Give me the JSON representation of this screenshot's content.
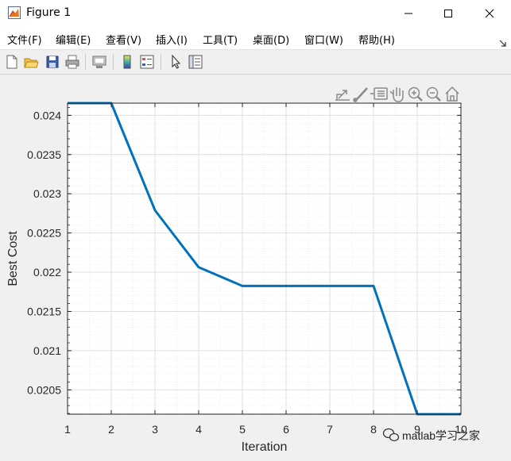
{
  "window": {
    "title": "Figure 1",
    "icon": "matlab-figure-icon",
    "controls": [
      "minimize-icon",
      "maximize-icon",
      "close-icon"
    ]
  },
  "menu": [
    "文件(F)",
    "编辑(E)",
    "查看(V)",
    "插入(I)",
    "工具(T)",
    "桌面(D)",
    "窗口(W)",
    "帮助(H)"
  ],
  "toolbar": [
    "new-figure-icon",
    "open-file-icon",
    "save-icon",
    "print-icon",
    "link-plot-icon",
    "insert-colorbar-icon",
    "insert-legend-icon",
    "edit-plot-icon",
    "property-inspector-icon"
  ],
  "axes_toolbar": [
    "export-icon",
    "brush-icon",
    "data-tips-icon",
    "pan-icon",
    "zoom-in-icon",
    "zoom-out-icon",
    "home-icon"
  ],
  "watermark": "matlab学习之家",
  "colors": {
    "line": "#0072BD",
    "grid": "#dfdfdf",
    "axes_bg": "#ffffff"
  },
  "chart_data": {
    "type": "line",
    "xlabel": "Iteration",
    "ylabel": "Best Cost",
    "xlim": [
      1,
      10
    ],
    "ylim": [
      0.02019,
      0.024155
    ],
    "x_ticks": [
      "1",
      "2",
      "3",
      "4",
      "5",
      "6",
      "7",
      "8",
      "9",
      "10"
    ],
    "y_ticks": [
      "0.0205",
      "0.021",
      "0.0215",
      "0.022",
      "0.0225",
      "0.023",
      "0.0235",
      "0.024"
    ],
    "grid": true,
    "minor_grid": true,
    "x": [
      1,
      2,
      3,
      4,
      5,
      6,
      7,
      8,
      9,
      10
    ],
    "y": [
      0.024155,
      0.024155,
      0.02279,
      0.022063,
      0.021825,
      0.021825,
      0.021825,
      0.021825,
      0.02019,
      0.02019
    ]
  }
}
